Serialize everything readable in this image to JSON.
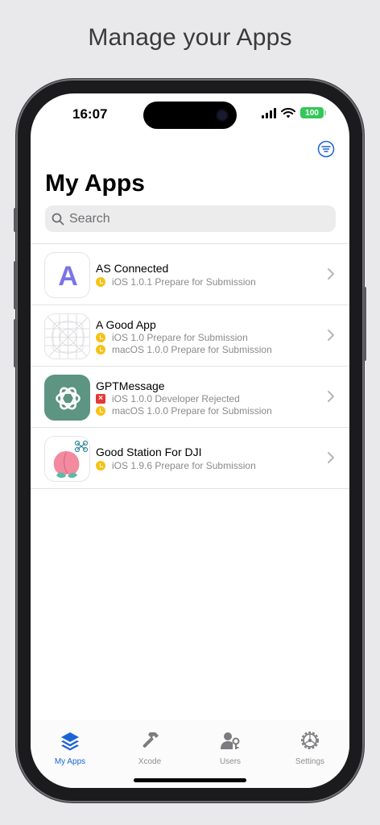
{
  "headline": "Manage your Apps",
  "status": {
    "time": "16:07",
    "battery": "100"
  },
  "page": {
    "title": "My Apps"
  },
  "search": {
    "placeholder": "Search"
  },
  "apps": [
    {
      "name": "AS Connected",
      "icon": "letter-a-icon",
      "statuses": [
        {
          "state": "pending",
          "text": "iOS 1.0.1 Prepare for Submission"
        }
      ]
    },
    {
      "name": "A Good App",
      "icon": "app-template-grid-icon",
      "statuses": [
        {
          "state": "pending",
          "text": "iOS 1.0 Prepare for Submission"
        },
        {
          "state": "pending",
          "text": "macOS 1.0.0 Prepare for Submission"
        }
      ]
    },
    {
      "name": "GPTMessage",
      "icon": "openai-knot-icon",
      "statuses": [
        {
          "state": "rejected",
          "text": "iOS 1.0.0 Developer Rejected"
        },
        {
          "state": "pending",
          "text": "macOS 1.0.0 Prepare for Submission"
        }
      ]
    },
    {
      "name": "Good Station For DJI",
      "icon": "peach-drone-icon",
      "statuses": [
        {
          "state": "pending",
          "text": "iOS 1.9.6 Prepare for Submission"
        }
      ]
    }
  ],
  "tabs": [
    {
      "label": "My Apps",
      "icon": "stack-layers-icon",
      "active": true
    },
    {
      "label": "Xcode",
      "icon": "hammer-icon",
      "active": false
    },
    {
      "label": "Users",
      "icon": "users-key-icon",
      "active": false
    },
    {
      "label": "Settings",
      "icon": "gear-icon",
      "active": false
    }
  ],
  "colors": {
    "accent": "#1c63d4",
    "pending": "#f7c215",
    "rejected": "#e53935",
    "battery": "#34c759"
  }
}
